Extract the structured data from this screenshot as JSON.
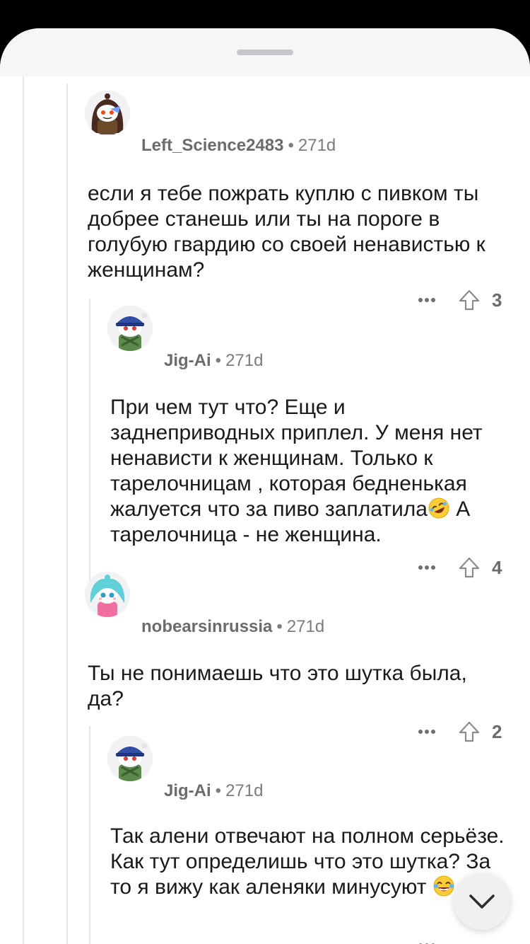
{
  "colors": {
    "background": "#000000",
    "sheet": "#ffffff",
    "header": "#f6f6f7",
    "text": "#1a1a1b",
    "meta": "#7c7c80",
    "thread_line": "#e6e6e8"
  },
  "comments": [
    {
      "username": "Left_Science2483",
      "separator": "•",
      "age": "271d",
      "body": "если я тебе пожрать куплю с пивком ты добрее станешь или ты на пороге в голубую гвардию со своей ненавистью к женщинам?",
      "score": "3",
      "avatar": "avatar-brown-hair-icon"
    },
    {
      "username": "Jig-Ai",
      "separator": "•",
      "age": "271d",
      "body_before_emoji": "При чем тут что? Еще и заднеприводных приплел.  У меня нет ненависти к женщинам. Только к тарелочницам , которая  бедненькая жалуется что за пиво заплатила",
      "emoji": "rolling-laughing-emoji",
      "body_after_emoji": " А тарелочница - не женщина.",
      "score": "4",
      "avatar": "avatar-blue-cap-icon"
    },
    {
      "username": "nobearsinrussia",
      "separator": "•",
      "age": "271d",
      "body": "Ты не понимаешь что это шутка была, да?",
      "score": "2",
      "avatar": "avatar-teal-hair-icon"
    },
    {
      "username": "Jig-Ai",
      "separator": "•",
      "age": "271d",
      "body_before_emoji": "Так алени отвечают на полном серьёзе. Как тут определишь что это шутка? За то я вижу как аленяки минусуют ",
      "emoji": "tears-of-joy-emoji",
      "score": "",
      "avatar": "avatar-blue-cap-icon"
    }
  ],
  "fab": {
    "icon": "chevron-down-icon"
  }
}
